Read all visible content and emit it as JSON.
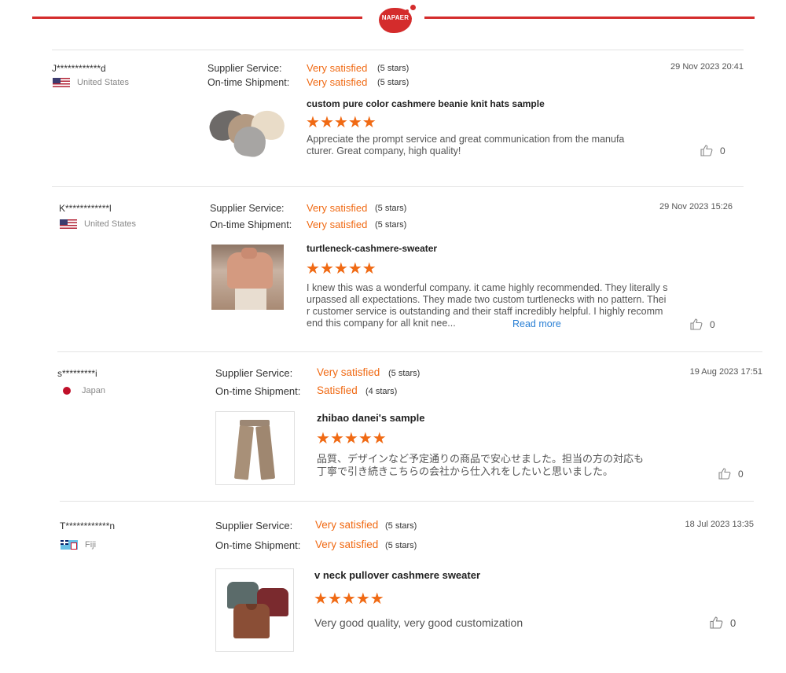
{
  "brand": {
    "logo_text": "NAPAER"
  },
  "labels": {
    "supplier_service": "Supplier Service:",
    "ontime_shipment": "On-time Shipment:",
    "read_more": "Read more"
  },
  "colors": {
    "accent": "#f06a14",
    "brand_red": "#d42c2c",
    "link": "#2a7fd4"
  },
  "reviews": [
    {
      "user": "J************d",
      "country": "United States",
      "flag_icon": "us-flag-icon",
      "supplier_service": {
        "rating": "Very satisfied",
        "stars": "(5 stars)"
      },
      "ontime_shipment": {
        "rating": "Very satisfied",
        "stars": "(5 stars)"
      },
      "date": "29 Nov 2023 20:41",
      "product": "custom pure color cashmere beanie knit hats sample",
      "comment_lines": [
        "Appreciate the prompt service and great communication from the manufa",
        "cturer. Great company, high quality!"
      ],
      "likes": "0"
    },
    {
      "user": "K************l",
      "country": "United States",
      "flag_icon": "us-flag-icon",
      "supplier_service": {
        "rating": "Very satisfied",
        "stars": "(5 stars)"
      },
      "ontime_shipment": {
        "rating": "Very satisfied",
        "stars": "(5 stars)"
      },
      "date": "29 Nov 2023 15:26",
      "product": "turtleneck-cashmere-sweater",
      "comment_lines": [
        "I knew this was a wonderful company. it came highly recommended. They literally s",
        "urpassed all expectations. They made two custom turtlenecks with no pattern. Thei",
        "r customer service is outstanding and their staff incredibly helpful. I highly recomm",
        "end this company for all knit nee..."
      ],
      "likes": "0"
    },
    {
      "user": "s*********i",
      "country": "Japan",
      "flag_icon": "japan-flag-icon",
      "supplier_service": {
        "rating": "Very satisfied",
        "stars": "(5 stars)"
      },
      "ontime_shipment": {
        "rating": "Satisfied",
        "stars": "(4 stars)"
      },
      "date": "19 Aug 2023 17:51",
      "product": "zhibao danei's sample",
      "comment_lines": [
        "品質、デザインなど予定通りの商品で安心せました。担当の方の対応も",
        "丁寧で引き続きこちらの会社から仕入れをしたいと思いました。"
      ],
      "likes": "0"
    },
    {
      "user": "T************n",
      "country": "Fiji",
      "flag_icon": "fiji-flag-icon",
      "supplier_service": {
        "rating": "Very satisfied",
        "stars": "(5 stars)"
      },
      "ontime_shipment": {
        "rating": "Very satisfied",
        "stars": "(5 stars)"
      },
      "date": "18 Jul 2023 13:35",
      "product": "v neck pullover cashmere sweater",
      "comment_lines": [
        "Very good quality, very good customization"
      ],
      "likes": "0"
    }
  ]
}
